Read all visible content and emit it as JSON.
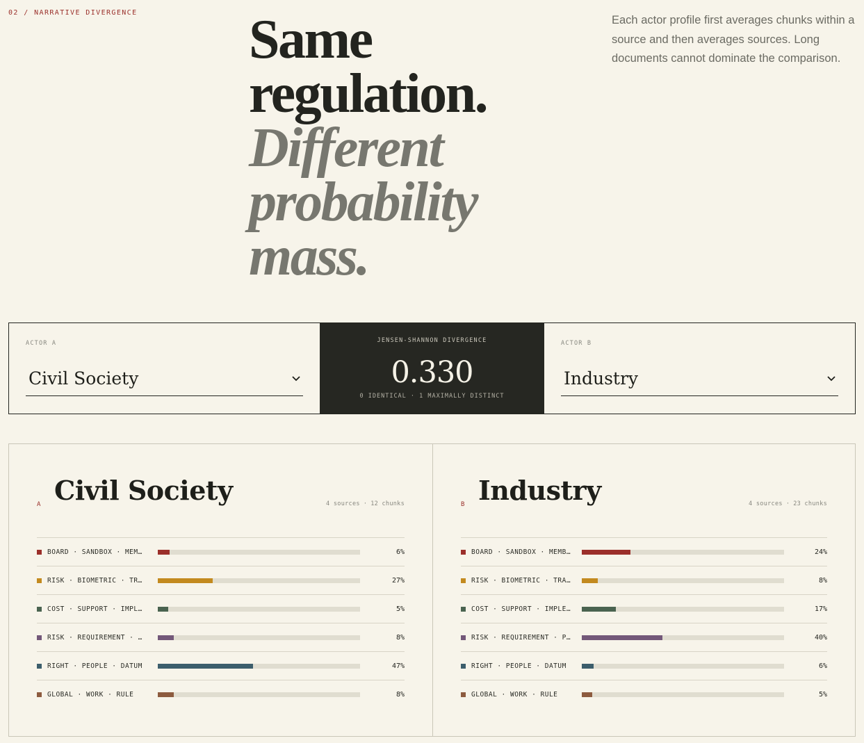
{
  "section": {
    "label": "02 / NARRATIVE DIVERGENCE"
  },
  "hero": {
    "line1": "Same",
    "line2": "regulation.",
    "line3": "Different",
    "line4": "probability",
    "line5": "mass."
  },
  "intro": "Each actor profile first averages chunks within a source and then averages sources. Long documents cannot dominate the comparison.",
  "selector": {
    "actor_a": {
      "kicker": "ACTOR A",
      "value": "Civil Society"
    },
    "actor_b": {
      "kicker": "ACTOR B",
      "value": "Industry"
    },
    "jsd": {
      "kicker": "JENSEN-SHANNON DIVERGENCE",
      "value": "0.330",
      "scale": "0 IDENTICAL · 1 MAXIMALLY DISTINCT"
    }
  },
  "panels": [
    {
      "letter": "A",
      "name": "Civil Society",
      "sources": "4 sources",
      "chunks": "12 chunks",
      "rows": [
        {
          "topic": "BOARD · SANDBOX · MEM…",
          "share": 0.06,
          "pct": "6%",
          "color": "#9b2f2a"
        },
        {
          "topic": "RISK · BIOMETRIC · TR…",
          "share": 0.27,
          "pct": "27%",
          "color": "#c38a1f"
        },
        {
          "topic": "COST · SUPPORT · IMPL…",
          "share": 0.05,
          "pct": "5%",
          "color": "#4a6350"
        },
        {
          "topic": "RISK · REQUIREMENT · …",
          "share": 0.08,
          "pct": "8%",
          "color": "#735879"
        },
        {
          "topic": "RIGHT · PEOPLE · DATUM",
          "share": 0.47,
          "pct": "47%",
          "color": "#3c5e6c"
        },
        {
          "topic": "GLOBAL · WORK · RULE",
          "share": 0.08,
          "pct": "8%",
          "color": "#8d5b3f"
        }
      ]
    },
    {
      "letter": "B",
      "name": "Industry",
      "sources": "4 sources",
      "chunks": "23 chunks",
      "rows": [
        {
          "topic": "BOARD · SANDBOX · MEMB…",
          "share": 0.24,
          "pct": "24%",
          "color": "#9b2f2a"
        },
        {
          "topic": "RISK · BIOMETRIC · TRA…",
          "share": 0.08,
          "pct": "8%",
          "color": "#c38a1f"
        },
        {
          "topic": "COST · SUPPORT · IMPLE…",
          "share": 0.17,
          "pct": "17%",
          "color": "#4a6350"
        },
        {
          "topic": "RISK · REQUIREMENT · P…",
          "share": 0.4,
          "pct": "40%",
          "color": "#735879"
        },
        {
          "topic": "RIGHT · PEOPLE · DATUM",
          "share": 0.06,
          "pct": "6%",
          "color": "#3c5e6c"
        },
        {
          "topic": "GLOBAL · WORK · RULE",
          "share": 0.05,
          "pct": "5%",
          "color": "#8d5b3f"
        }
      ]
    }
  ]
}
